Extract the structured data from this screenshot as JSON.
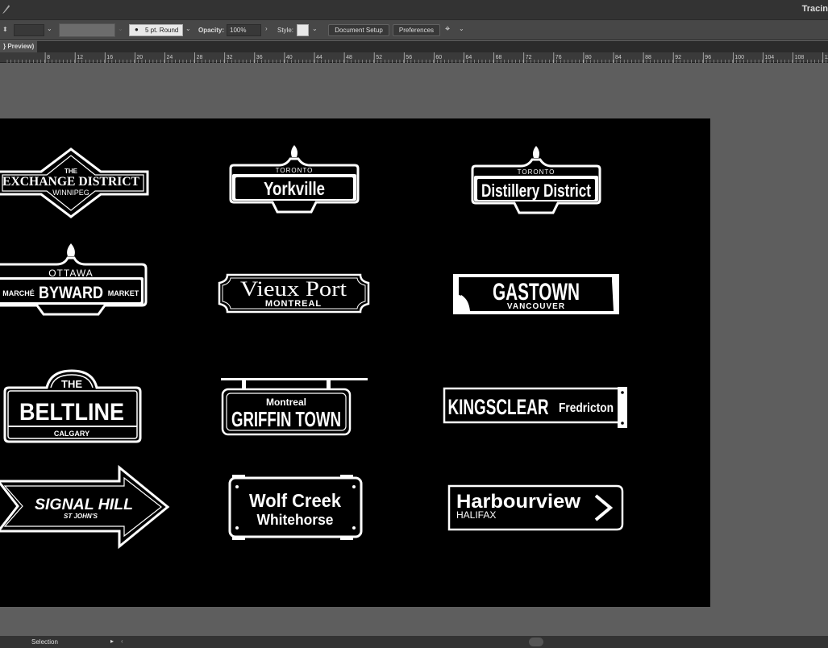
{
  "app": {
    "title": "Tracin"
  },
  "controlbar": {
    "stroke_profile": "5 pt. Round",
    "opacity_label": "Opacity:",
    "opacity_value": "100%",
    "style_label": "Style:",
    "document_setup_label": "Document Setup",
    "preferences_label": "Preferences",
    "icon_names": [
      "chevron-down-icon",
      "chevron-right-icon",
      "arrange-icon"
    ]
  },
  "tab": {
    "label": "} Preview)"
  },
  "ruler": {
    "ticks": [
      "8",
      "12",
      "16",
      "20",
      "24",
      "28",
      "32",
      "36",
      "40",
      "44",
      "48",
      "52",
      "56",
      "60",
      "64",
      "68",
      "72",
      "76",
      "80",
      "84",
      "88",
      "92",
      "96",
      "100",
      "104",
      "108",
      "112",
      "116"
    ]
  },
  "signs": {
    "exchange": {
      "top": "THE",
      "main": "EXCHANGE DISTRICT",
      "sub": "WINNIPEG"
    },
    "yorkville": {
      "top": "TORONTO",
      "main": "Yorkville"
    },
    "distillery": {
      "top": "TORONTO",
      "main": "Distillery District"
    },
    "byward": {
      "top": "OTTAWA",
      "left": "MARCHÉ",
      "main": "BYWARD",
      "right": "MARKET"
    },
    "vieux": {
      "main": "Vieux Port",
      "sub": "MONTREAL"
    },
    "gastown": {
      "main": "GASTOWN",
      "sub": "VANCOUVER"
    },
    "beltline": {
      "top": "THE",
      "main": "BELTLINE",
      "sub": "CALGARY"
    },
    "griffin": {
      "top": "Montreal",
      "main": "GRIFFIN TOWN"
    },
    "kingsclear": {
      "main": "KINGSCLEAR",
      "sub": "Fredricton"
    },
    "signal": {
      "main": "SIGNAL HILL",
      "sub": "ST JOHN'S"
    },
    "wolf": {
      "main": "Wolf Creek",
      "sub": "Whitehorse"
    },
    "harbour": {
      "main": "Harbourview",
      "sub": "HALIFAX"
    }
  },
  "colors": {
    "artboard": "#000000",
    "sign": "#ffffff",
    "pasteboard": "#5e5e5e"
  },
  "status": {
    "tool": "Selection"
  }
}
